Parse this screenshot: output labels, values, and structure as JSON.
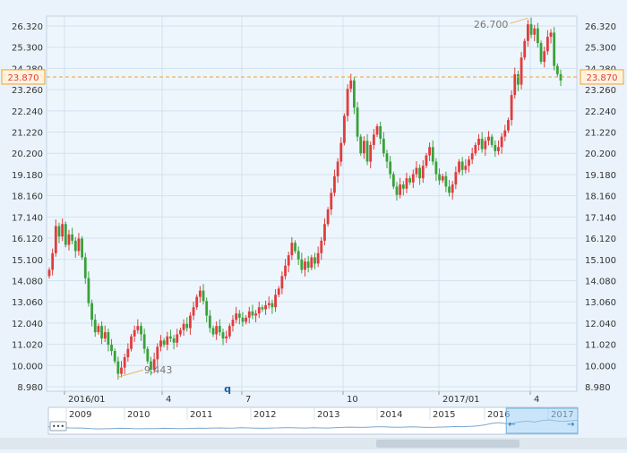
{
  "chart_data": {
    "type": "candlestick",
    "y_ticks": [
      "26.320",
      "25.300",
      "24.280",
      "23.260",
      "22.240",
      "21.220",
      "20.200",
      "19.180",
      "18.160",
      "17.140",
      "16.120",
      "15.100",
      "14.080",
      "13.060",
      "12.040",
      "11.020",
      "10.000",
      "8.980"
    ],
    "x_ticks": [
      "2016/01",
      "4",
      "7",
      "10",
      "2017/01",
      "4"
    ],
    "x_marker": "q",
    "ylim": [
      8.98,
      26.32
    ],
    "current_price": "23.870",
    "annotations": [
      {
        "label": "26.700",
        "value": 26.7
      },
      {
        "label": "9.443",
        "value": 9.443
      }
    ],
    "colors": {
      "up": "#e03c3c",
      "down": "#3aa13a",
      "price_line": "#f0a030",
      "price_label": "#e03c3c"
    },
    "closes": [
      14.6,
      15.4,
      16.7,
      16.2,
      16.8,
      15.8,
      16.3,
      16.0,
      15.5,
      16.1,
      15.2,
      14.2,
      13.0,
      12.2,
      11.6,
      11.9,
      11.3,
      11.6,
      11.0,
      10.7,
      10.2,
      9.6,
      9.9,
      10.4,
      10.8,
      11.4,
      11.7,
      11.9,
      11.5,
      10.8,
      10.2,
      9.8,
      10.3,
      10.9,
      11.2,
      11.0,
      11.4,
      11.3,
      11.1,
      11.5,
      11.7,
      12.0,
      11.8,
      12.4,
      12.8,
      13.3,
      13.6,
      13.1,
      12.4,
      11.8,
      11.5,
      11.9,
      11.6,
      11.3,
      11.4,
      11.9,
      12.2,
      12.5,
      12.3,
      12.1,
      12.3,
      12.6,
      12.4,
      12.5,
      12.8,
      12.7,
      12.9,
      13.0,
      12.8,
      13.4,
      13.7,
      14.3,
      14.8,
      15.3,
      15.9,
      15.5,
      15.1,
      14.6,
      15.0,
      14.7,
      15.2,
      14.9,
      15.4,
      16.0,
      16.8,
      17.5,
      18.3,
      19.1,
      19.8,
      20.7,
      22.0,
      23.3,
      23.7,
      22.4,
      21.0,
      20.2,
      20.8,
      19.8,
      20.6,
      21.1,
      21.5,
      20.9,
      20.2,
      19.8,
      19.2,
      18.6,
      18.2,
      18.7,
      18.5,
      19.0,
      18.8,
      19.2,
      19.5,
      19.0,
      19.6,
      20.1,
      20.5,
      19.8,
      19.2,
      18.9,
      19.1,
      18.6,
      18.3,
      18.7,
      19.3,
      19.8,
      19.4,
      19.6,
      19.9,
      20.2,
      20.6,
      20.9,
      20.4,
      20.8,
      21.0,
      20.6,
      20.3,
      20.5,
      21.0,
      21.3,
      21.8,
      23.0,
      24.0,
      23.5,
      24.8,
      25.6,
      26.4,
      25.9,
      26.2,
      25.5,
      24.6,
      25.1,
      25.8,
      26.0,
      24.4,
      24.0,
      23.7
    ],
    "navigator_years": [
      "2009",
      "2010",
      "2011",
      "2012",
      "2013",
      "2014",
      "2015",
      "2016",
      "2017"
    ],
    "navigator_series": [
      0.45,
      0.42,
      0.38,
      0.36,
      0.35,
      0.34,
      0.3,
      0.28,
      0.29,
      0.31,
      0.33,
      0.32,
      0.3,
      0.29,
      0.3,
      0.31,
      0.33,
      0.32,
      0.31,
      0.3,
      0.32,
      0.34,
      0.33,
      0.35,
      0.36,
      0.34,
      0.35,
      0.37,
      0.36,
      0.34,
      0.33,
      0.35,
      0.36,
      0.38,
      0.37,
      0.36,
      0.35,
      0.37,
      0.36,
      0.35,
      0.38,
      0.4,
      0.42,
      0.41,
      0.4,
      0.43,
      0.45,
      0.44,
      0.42,
      0.41,
      0.43,
      0.44,
      0.42,
      0.4,
      0.41,
      0.43,
      0.45,
      0.47,
      0.46,
      0.48,
      0.52,
      0.6,
      0.72,
      0.78,
      0.7,
      0.75,
      0.85,
      0.9,
      0.82,
      0.95,
      1.0,
      0.92,
      0.88,
      0.93,
      0.97
    ],
    "navigator_window": [
      0.865,
      1.0
    ]
  },
  "ui": {
    "navigator_menu_label": "•••"
  }
}
